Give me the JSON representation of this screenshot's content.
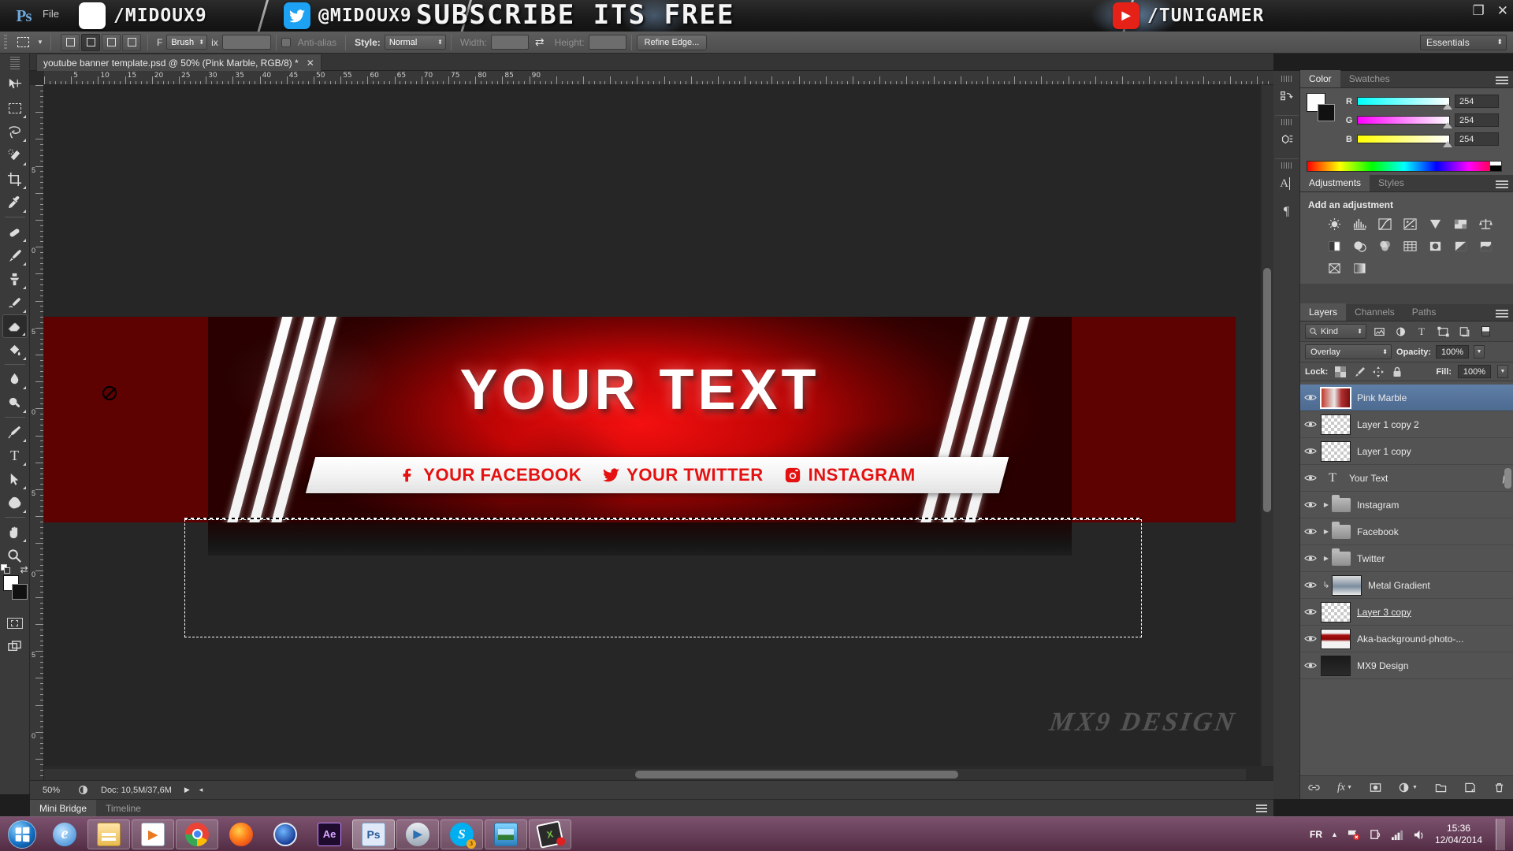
{
  "banner": {
    "app_logo": "Ps",
    "file_menu": "File",
    "facebook_handle": "/MIDOUX9",
    "twitter_handle": "@MIDOUX9",
    "subscribe_text": "SUBSCRIBE ITS FREE",
    "youtube_handle": "/TUNIGAMER",
    "window_restore": "❐",
    "window_close": "✕"
  },
  "options_bar": {
    "tool_icon": "rectangular-marquee",
    "mode_buttons": [
      "new-selection",
      "add-to-selection",
      "subtract-from-selection",
      "intersect-selection"
    ],
    "feather_label": "F",
    "feather_value": "Brush",
    "feather_unit": "ix",
    "antialias_label": "Anti-alias",
    "style_label": "Style:",
    "style_value": "Normal",
    "width_label": "Width:",
    "width_value": "",
    "swap_icon": "swap-arrows",
    "height_label": "Height:",
    "height_value": "",
    "refine_edge": "Refine Edge...",
    "workspace": "Essentials"
  },
  "toolbar": {
    "tools": [
      {
        "name": "move-tool",
        "active": false
      },
      {
        "name": "rectangular-marquee-tool",
        "active": false
      },
      {
        "name": "lasso-tool",
        "active": false
      },
      {
        "name": "quick-selection-tool",
        "active": false
      },
      {
        "name": "crop-tool",
        "active": false
      },
      {
        "name": "eyedropper-tool",
        "active": false
      },
      {
        "name": "healing-brush-tool",
        "active": false
      },
      {
        "name": "brush-tool",
        "active": false
      },
      {
        "name": "clone-stamp-tool",
        "active": false
      },
      {
        "name": "history-brush-tool",
        "active": false
      },
      {
        "name": "eraser-tool",
        "active": true
      },
      {
        "name": "gradient-tool",
        "active": false
      },
      {
        "name": "blur-tool",
        "active": false
      },
      {
        "name": "dodge-tool",
        "active": false
      },
      {
        "name": "pen-tool",
        "active": false
      },
      {
        "name": "type-tool",
        "active": false
      },
      {
        "name": "path-selection-tool",
        "active": false
      },
      {
        "name": "shape-tool",
        "active": false
      },
      {
        "name": "hand-tool",
        "active": false
      },
      {
        "name": "zoom-tool",
        "active": false
      }
    ],
    "foreground_color": "#fefefe",
    "background_color": "#111111"
  },
  "document": {
    "tab_title": "youtube banner template.psd @ 50% (Pink Marble, RGB/8) *",
    "close_label": "✕",
    "ruler_marks": [
      5,
      10,
      15,
      20,
      25,
      30,
      35,
      40,
      45,
      50,
      55,
      60,
      65,
      70,
      75,
      80,
      85,
      90
    ],
    "ruler_marks_v": [
      5,
      0,
      5,
      0,
      5,
      0,
      5,
      0
    ]
  },
  "artwork": {
    "headline": "YOUR TEXT",
    "social": [
      {
        "icon": "facebook-icon",
        "label": "YOUR FACEBOOK"
      },
      {
        "icon": "twitter-icon",
        "label": "YOUR TWITTER"
      },
      {
        "icon": "instagram-icon",
        "label": "INSTAGRAM"
      }
    ],
    "watermark": "MX9 DESIGN"
  },
  "status_bar": {
    "zoom": "50%",
    "doc_size": "Doc: 10,5M/37,6M",
    "arrow": "▶",
    "arrow_left": "◂"
  },
  "bottom_panels": {
    "tabs": [
      {
        "label": "Mini Bridge",
        "active": true
      },
      {
        "label": "Timeline",
        "active": false
      }
    ]
  },
  "mini_dock": {
    "items": [
      "history-icon",
      "3d-icon",
      "character-icon",
      "paragraph-icon"
    ]
  },
  "color_panel": {
    "tabs": [
      {
        "label": "Color",
        "active": true
      },
      {
        "label": "Swatches",
        "active": false
      }
    ],
    "channels": [
      {
        "label": "R",
        "value": "254"
      },
      {
        "label": "G",
        "value": "254"
      },
      {
        "label": "B",
        "value": "254"
      }
    ]
  },
  "adjustments_panel": {
    "tabs": [
      {
        "label": "Adjustments",
        "active": true
      },
      {
        "label": "Styles",
        "active": false
      }
    ],
    "title": "Add an adjustment",
    "icons": [
      "brightness-contrast-icon",
      "levels-icon",
      "curves-icon",
      "exposure-icon",
      "vibrance-icon",
      "hue-saturation-icon",
      "color-balance-icon",
      "black-white-icon",
      "photo-filter-icon",
      "channel-mixer-icon",
      "color-lookup-icon",
      "invert-icon",
      "posterize-icon",
      "threshold-icon",
      "gradient-map-icon",
      "selective-color-icon"
    ]
  },
  "layers_panel": {
    "tabs": [
      {
        "label": "Layers",
        "active": true
      },
      {
        "label": "Channels",
        "active": false
      },
      {
        "label": "Paths",
        "active": false
      }
    ],
    "filter_kind": "Kind",
    "filter_icons": [
      "pixel-filter-icon",
      "adjustment-filter-icon",
      "type-filter-icon",
      "shape-filter-icon",
      "smart-object-filter-icon",
      "filter-toggle-icon"
    ],
    "blend_mode": "Overlay",
    "opacity_label": "Opacity:",
    "opacity_value": "100%",
    "lock_label": "Lock:",
    "lock_icons": [
      "lock-transparent-icon",
      "lock-image-icon",
      "lock-position-icon",
      "lock-all-icon"
    ],
    "fill_label": "Fill:",
    "fill_value": "100%",
    "layers": [
      {
        "name": "Pink Marble",
        "type": "image",
        "visible": true,
        "selected": true,
        "fx": false,
        "underline": false,
        "clipped": false
      },
      {
        "name": "Layer 1 copy 2",
        "type": "image",
        "visible": true,
        "selected": false,
        "fx": false,
        "underline": false,
        "clipped": false
      },
      {
        "name": "Layer 1 copy",
        "type": "image",
        "visible": true,
        "selected": false,
        "fx": false,
        "underline": false,
        "clipped": false
      },
      {
        "name": "Your Text",
        "type": "text",
        "visible": true,
        "selected": false,
        "fx": true,
        "underline": false,
        "clipped": false
      },
      {
        "name": "Instagram",
        "type": "group",
        "visible": true,
        "selected": false,
        "fx": false,
        "underline": false,
        "clipped": false
      },
      {
        "name": "Facebook",
        "type": "group",
        "visible": true,
        "selected": false,
        "fx": false,
        "underline": false,
        "clipped": false
      },
      {
        "name": "Twitter",
        "type": "group",
        "visible": true,
        "selected": false,
        "fx": false,
        "underline": false,
        "clipped": false
      },
      {
        "name": "Metal Gradient",
        "type": "image",
        "visible": true,
        "selected": false,
        "fx": false,
        "underline": false,
        "clipped": true
      },
      {
        "name": "Layer 3 copy",
        "type": "image",
        "visible": true,
        "selected": false,
        "fx": false,
        "underline": true,
        "clipped": false
      },
      {
        "name": "Aka-background-photo-...",
        "type": "image",
        "visible": true,
        "selected": false,
        "fx": false,
        "underline": false,
        "clipped": false
      },
      {
        "name": "MX9 Design",
        "type": "image",
        "visible": true,
        "selected": false,
        "fx": false,
        "underline": false,
        "clipped": false
      }
    ],
    "footer_icons": [
      "link-layers-icon",
      "layer-style-icon",
      "layer-mask-icon",
      "adjustment-layer-icon",
      "new-group-icon",
      "new-layer-icon",
      "delete-layer-icon"
    ]
  },
  "taskbar": {
    "start": "windows-start-orb",
    "items": [
      {
        "name": "internet-explorer-icon",
        "label": "e",
        "running": false
      },
      {
        "name": "windows-explorer-icon",
        "label": "",
        "running": true
      },
      {
        "name": "windows-media-player-icon",
        "label": "",
        "running": true
      },
      {
        "name": "google-chrome-icon",
        "label": "",
        "running": true
      },
      {
        "name": "mozilla-firefox-icon",
        "label": "",
        "running": false
      },
      {
        "name": "opera-icon",
        "label": "",
        "running": false
      },
      {
        "name": "after-effects-icon",
        "label": "Ae",
        "running": false
      },
      {
        "name": "photoshop-icon",
        "label": "Ps",
        "running": true
      },
      {
        "name": "media-player-classic-icon",
        "label": "",
        "running": true
      },
      {
        "name": "skype-icon",
        "label": "S",
        "running": true
      },
      {
        "name": "photo-viewer-icon",
        "label": "",
        "running": true
      },
      {
        "name": "screen-recorder-icon",
        "label": "",
        "running": true
      }
    ],
    "tray": {
      "language": "FR",
      "show_hidden": "▲",
      "network_icon": "network-error-icon",
      "action_center_icon": "action-center-icon",
      "signal_icon": "signal-bars-icon",
      "volume_icon": "volume-icon",
      "time": "15:36",
      "date": "12/04/2014"
    }
  }
}
